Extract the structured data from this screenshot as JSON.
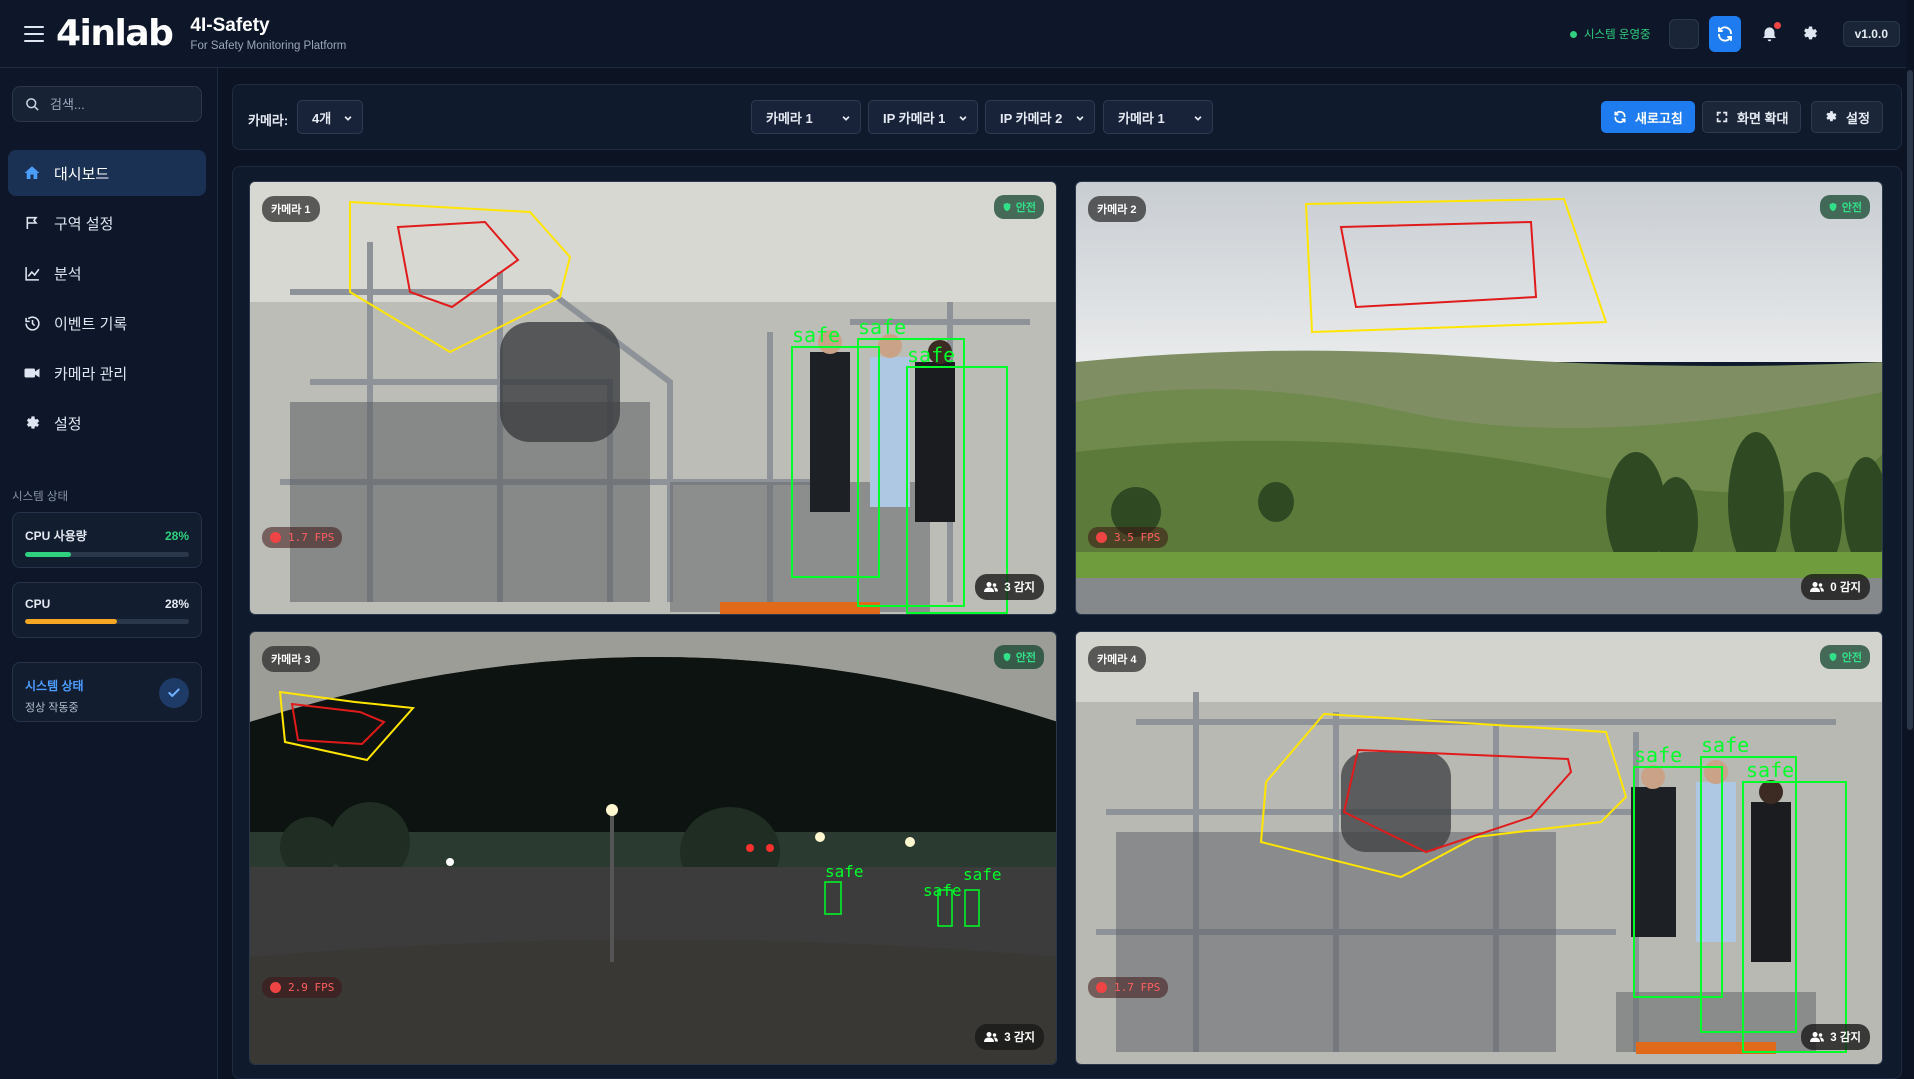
{
  "header": {
    "logo_text": "4inlab",
    "brand_title": "4I-Safety",
    "brand_subtitle": "For Safety Monitoring Platform",
    "status_text": "시스템 운영중",
    "version": "v1.0.0",
    "icons": [
      "menu-icon",
      "refresh-icon",
      "bell-icon",
      "gear-icon"
    ]
  },
  "sidebar": {
    "search_placeholder": "검색...",
    "items": [
      {
        "label": "대시보드",
        "icon": "home-icon",
        "active": true
      },
      {
        "label": "구역 설정",
        "icon": "zone-icon"
      },
      {
        "label": "분석",
        "icon": "chart-line-icon"
      },
      {
        "label": "이벤트 기록",
        "icon": "history-icon"
      },
      {
        "label": "카메라 관리",
        "icon": "video-icon"
      },
      {
        "label": "설정",
        "icon": "gear-icon"
      }
    ],
    "section_title": "시스템 상태",
    "cpu_usage": {
      "label": "CPU 사용량",
      "value": "28%",
      "fraction": 0.28,
      "color": "#2fd17f"
    },
    "cpu": {
      "label": "CPU",
      "value": "28%",
      "fraction": 0.56,
      "color": "#f5a623"
    },
    "system_status": {
      "title": "시스템 상태",
      "subtitle": "정상 작동중"
    }
  },
  "toolbar": {
    "camera_label": "카메라:",
    "camera_count": "4개",
    "selects": [
      "카메라 1",
      "IP 카메라 1",
      "IP 카메라 2",
      "카메라 1"
    ],
    "refresh_label": "새로고침",
    "fullscreen_label": "화면 확대",
    "settings_label": "설정"
  },
  "cameras": [
    {
      "label": "카메라 1",
      "status": "안전",
      "fps": "1.7 FPS",
      "count": "3 감지",
      "detections": [
        "safe",
        "safe",
        "safe"
      ]
    },
    {
      "label": "카메라 2",
      "status": "안전",
      "fps": "3.5 FPS",
      "count": "0 감지",
      "detections": []
    },
    {
      "label": "카메라 3",
      "status": "안전",
      "fps": "2.9 FPS",
      "count": "3 감지",
      "detections": [
        "safe",
        "safe",
        "safe"
      ]
    },
    {
      "label": "카메라 4",
      "status": "안전",
      "fps": "1.7 FPS",
      "count": "3 감지",
      "detections": [
        "safe",
        "safe",
        "safe"
      ]
    }
  ],
  "colors": {
    "accent": "#1e7cf0",
    "safe": "#2fd17f",
    "zone_warning": "#ffe600",
    "zone_danger": "#e01b1b",
    "detection": "#00ff2a"
  }
}
